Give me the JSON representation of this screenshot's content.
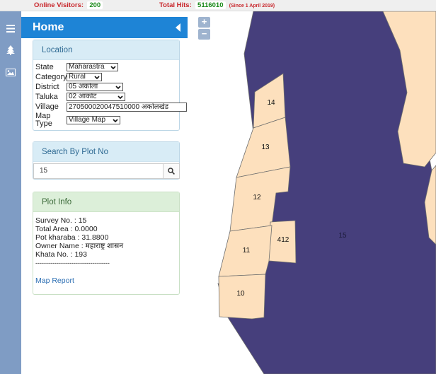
{
  "stats": {
    "visitors_label": "Online Visitors:",
    "visitors_value": "200",
    "hits_label": "Total Hits:",
    "hits_value": "5116010",
    "hits_since": "(Since 1 April 2019)"
  },
  "header": {
    "title": "Home"
  },
  "location": {
    "title": "Location",
    "state_label": "State",
    "state_value": "Maharastra",
    "category_label": "Category",
    "category_value": "Rural",
    "district_label": "District",
    "district_value": "05 अकोला",
    "taluka_label": "Taluka",
    "taluka_value": "02 आकोट",
    "village_label": "Village",
    "village_value": "270500020047510000 अकोलखेड",
    "maptype_label": "Map Type",
    "maptype_value": "Village Map"
  },
  "search": {
    "title": "Search By Plot No",
    "value": "15"
  },
  "plot_info": {
    "title": "Plot Info",
    "lines": [
      "Survey No. : 15",
      "Total Area : 0.0000",
      "Pot kharaba : 31.8800",
      "Owner Name : महाराष्ट्र शासन",
      "Khata No. : 193",
      "-----------------------------------"
    ],
    "report_link": "Map Report"
  },
  "map": {
    "zoom_in": "+",
    "zoom_out": "−",
    "plots": [
      "14",
      "13",
      "12",
      "11",
      "412",
      "10",
      "15"
    ],
    "colors": {
      "selected": "#463f7c",
      "plot": "#fde0bd",
      "outline": "#6e6e6e"
    }
  }
}
